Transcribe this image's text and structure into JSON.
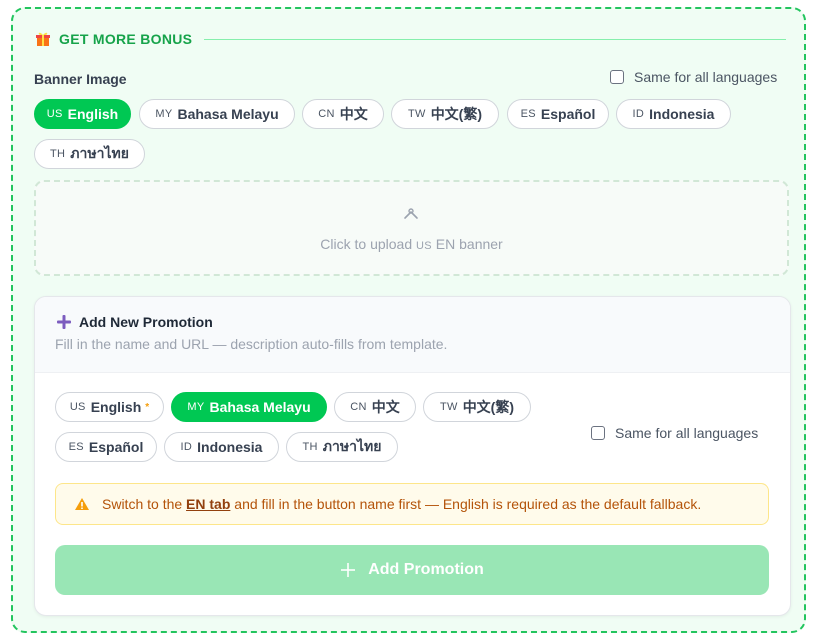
{
  "section": {
    "title": "GET MORE BONUS",
    "icon": "gift-icon"
  },
  "banner": {
    "label": "Banner Image",
    "same_for_all": "Same for all languages",
    "tabs": [
      {
        "code": "US",
        "name": "English",
        "active": true
      },
      {
        "code": "MY",
        "name": "Bahasa Melayu",
        "active": false
      },
      {
        "code": "CN",
        "name": "中文",
        "active": false
      },
      {
        "code": "TW",
        "name": "中文(繁)",
        "active": false
      },
      {
        "code": "ES",
        "name": "Español",
        "active": false
      },
      {
        "code": "ID",
        "name": "Indonesia",
        "active": false
      },
      {
        "code": "TH",
        "name": "ภาษาไทย",
        "active": false
      }
    ],
    "upload": {
      "prefix": "Click to upload",
      "code": "US",
      "suffix": "EN banner"
    }
  },
  "promotion": {
    "title": "Add New Promotion",
    "subtitle": "Fill in the name and URL — description auto-fills from template.",
    "same_for_all": "Same for all languages",
    "required_mark": "*",
    "tabs": [
      {
        "code": "US",
        "name": "English",
        "active": false,
        "required": true
      },
      {
        "code": "MY",
        "name": "Bahasa Melayu",
        "active": true
      },
      {
        "code": "CN",
        "name": "中文",
        "active": false
      },
      {
        "code": "TW",
        "name": "中文(繁)",
        "active": false
      },
      {
        "code": "ES",
        "name": "Español",
        "active": false
      },
      {
        "code": "ID",
        "name": "Indonesia",
        "active": false
      },
      {
        "code": "TH",
        "name": "ภาษาไทย",
        "active": false
      }
    ],
    "warning": {
      "before": "Switch to the ",
      "link": "EN tab",
      "after": " and fill in the button name first — English is required as the default fallback."
    },
    "add_button": "Add Promotion"
  },
  "colors": {
    "accent": "#00c853",
    "frame_border": "#22c55e",
    "frame_bg": "#f0fdf4",
    "button_disabled": "#99e6b5",
    "warning_bg": "#fffbeb",
    "warning_text": "#b45309"
  }
}
